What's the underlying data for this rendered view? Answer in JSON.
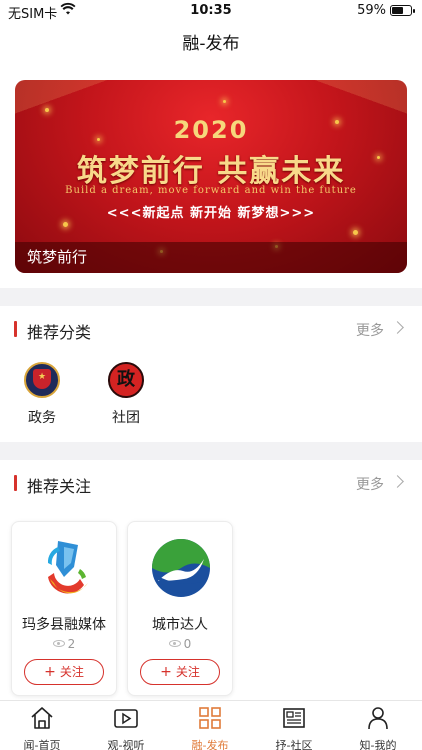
{
  "status_bar": {
    "carrier": "无SIM卡",
    "time": "10:35",
    "battery": "59%",
    "battery_level": 0.59
  },
  "navbar": {
    "title": "融-发布"
  },
  "banner": {
    "year": "2020",
    "headline": "筑梦前行 共赢未来",
    "subtitle_en": "Build a dream, move forward and win the future",
    "slogan": "<<<新起点 新开始 新梦想>>>",
    "caption": "筑梦前行",
    "colors": {
      "bg": "#c3151b",
      "gold": "#f6d77c"
    }
  },
  "categories_section": {
    "title": "推荐分类",
    "more": "更多",
    "items": [
      {
        "label": "政务",
        "icon": "police-badge-icon"
      },
      {
        "label": "社团",
        "icon": "zheng-seal-icon",
        "icon_text": "政"
      }
    ]
  },
  "follow_section": {
    "title": "推荐关注",
    "more": "更多",
    "cards": [
      {
        "name": "玛多县融媒体",
        "views": "2",
        "button": "关注",
        "icon": "maduo-media-logo-icon"
      },
      {
        "name": "城市达人",
        "views": "0",
        "button": "关注",
        "icon": "city-expert-logo-icon"
      }
    ]
  },
  "tabbar": {
    "active_index": 2,
    "active_color": "#e07b3a",
    "tabs": [
      {
        "label": "闻-首页",
        "icon": "home-icon"
      },
      {
        "label": "观-视听",
        "icon": "video-icon"
      },
      {
        "label": "融-发布",
        "icon": "grid-icon"
      },
      {
        "label": "抒-社区",
        "icon": "newspaper-icon"
      },
      {
        "label": "知-我的",
        "icon": "person-icon"
      }
    ]
  }
}
